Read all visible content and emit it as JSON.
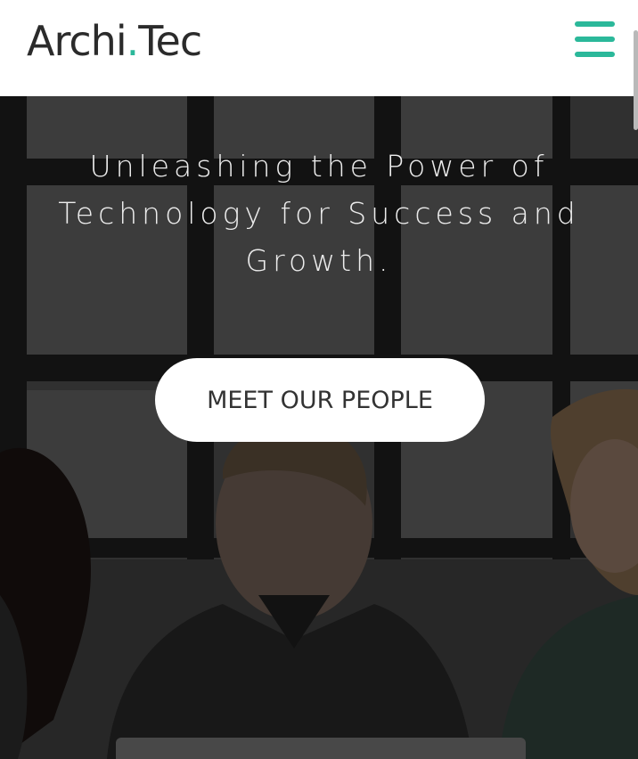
{
  "header": {
    "logo_main": "Archi",
    "logo_dot": ".",
    "logo_suffix": "Tec",
    "menu_icon": "hamburger-menu-icon"
  },
  "hero": {
    "tagline": "Unleashing the Power of Technology for Success and Growth.",
    "cta_label": "MEET OUR PEOPLE"
  },
  "colors": {
    "accent": "#2bb89a",
    "header_bg": "#ffffff",
    "logo_text": "#2b2b2b",
    "overlay": "#000000"
  }
}
